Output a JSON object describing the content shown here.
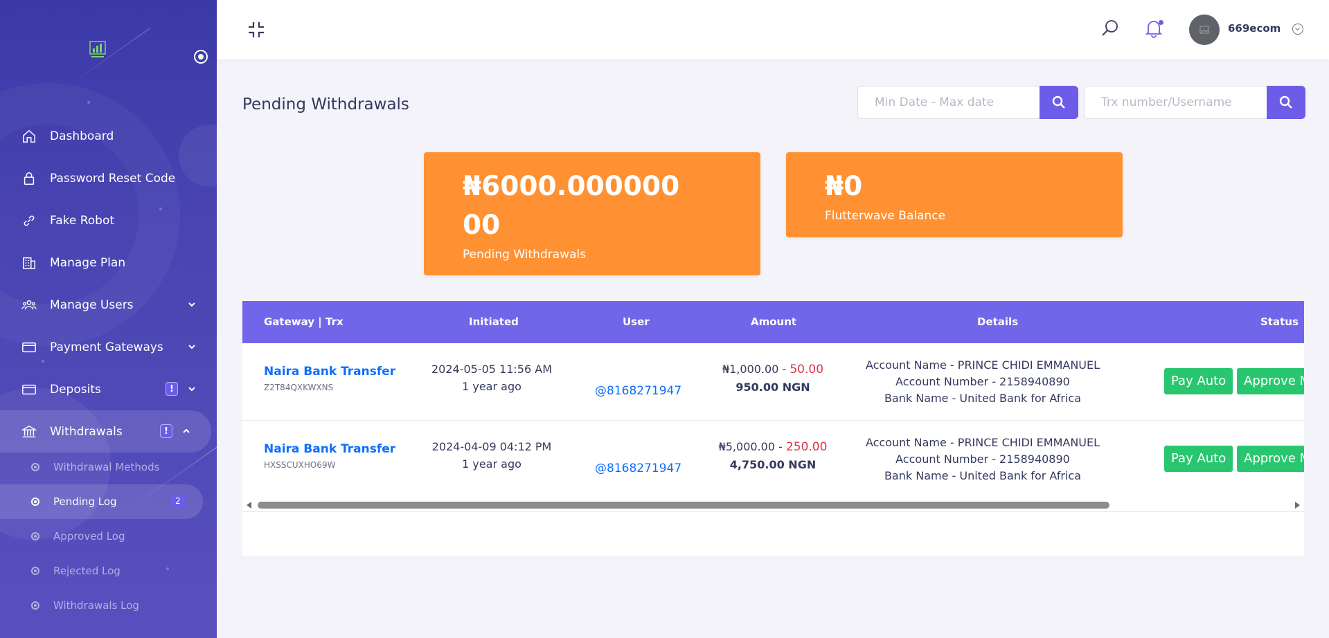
{
  "sidebar": {
    "items": [
      {
        "label": "Dashboard",
        "icon": "home-icon"
      },
      {
        "label": "Password Reset Code",
        "icon": "lock-icon"
      },
      {
        "label": "Fake Robot",
        "icon": "link-icon"
      },
      {
        "label": "Manage Plan",
        "icon": "building-icon"
      },
      {
        "label": "Manage Users",
        "icon": "users-icon"
      },
      {
        "label": "Payment Gateways",
        "icon": "credit-card-icon"
      },
      {
        "label": "Deposits",
        "icon": "credit-card-icon",
        "badge": "!"
      },
      {
        "label": "Withdrawals",
        "icon": "bank-icon",
        "badge": "!"
      }
    ],
    "withdrawals_submenu": [
      {
        "label": "Withdrawal Methods"
      },
      {
        "label": "Pending Log",
        "count": "2"
      },
      {
        "label": "Approved Log"
      },
      {
        "label": "Rejected Log"
      },
      {
        "label": "Withdrawals Log"
      }
    ]
  },
  "topbar": {
    "username": "669ecom"
  },
  "page": {
    "title": "Pending Withdrawals",
    "date_placeholder": "Min Date - Max date",
    "trx_placeholder": "Trx number/Username"
  },
  "cards": {
    "pending_amount": "₦6000.00000000",
    "pending_label": "Pending Withdrawals",
    "flutter_amount": "₦0",
    "flutter_label": "Flutterwave Balance"
  },
  "table": {
    "headers": [
      "Gateway | Trx",
      "Initiated",
      "User",
      "Amount",
      "Details",
      "Status"
    ],
    "rows": [
      {
        "gateway": "Naira Bank Transfer",
        "trx": "Z2T84QXKWXNS",
        "date": "2024-05-05 11:56 AM",
        "ago": "1 year ago",
        "user": "@8168271947",
        "amount": "₦1,000.00",
        "sep": " - ",
        "charge": "50.00",
        "net": "950.00 NGN",
        "account_name": "Account Name - PRINCE CHIDI EMMANUEL",
        "account_number": "Account Number - 2158940890",
        "bank_name": "Bank Name - United Bank for Africa",
        "btn_auto": "Pay Auto",
        "btn_approve": "Approve Manually"
      },
      {
        "gateway": "Naira Bank Transfer",
        "trx": "HXSSCUXHO69W",
        "date": "2024-04-09 04:12 PM",
        "ago": "1 year ago",
        "user": "@8168271947",
        "amount": "₦5,000.00",
        "sep": " - ",
        "charge": "250.00",
        "net": "4,750.00 NGN",
        "account_name": "Account Name - PRINCE CHIDI EMMANUEL",
        "account_number": "Account Number - 2158940890",
        "bank_name": "Bank Name - United Bank for Africa",
        "btn_auto": "Pay Auto",
        "btn_approve": "Approve Manually"
      }
    ]
  },
  "colors": {
    "primary": "#6c5ce7",
    "card": "#ff9133",
    "success": "#28c76f",
    "link": "#0d6efd",
    "danger": "#dc3545"
  }
}
